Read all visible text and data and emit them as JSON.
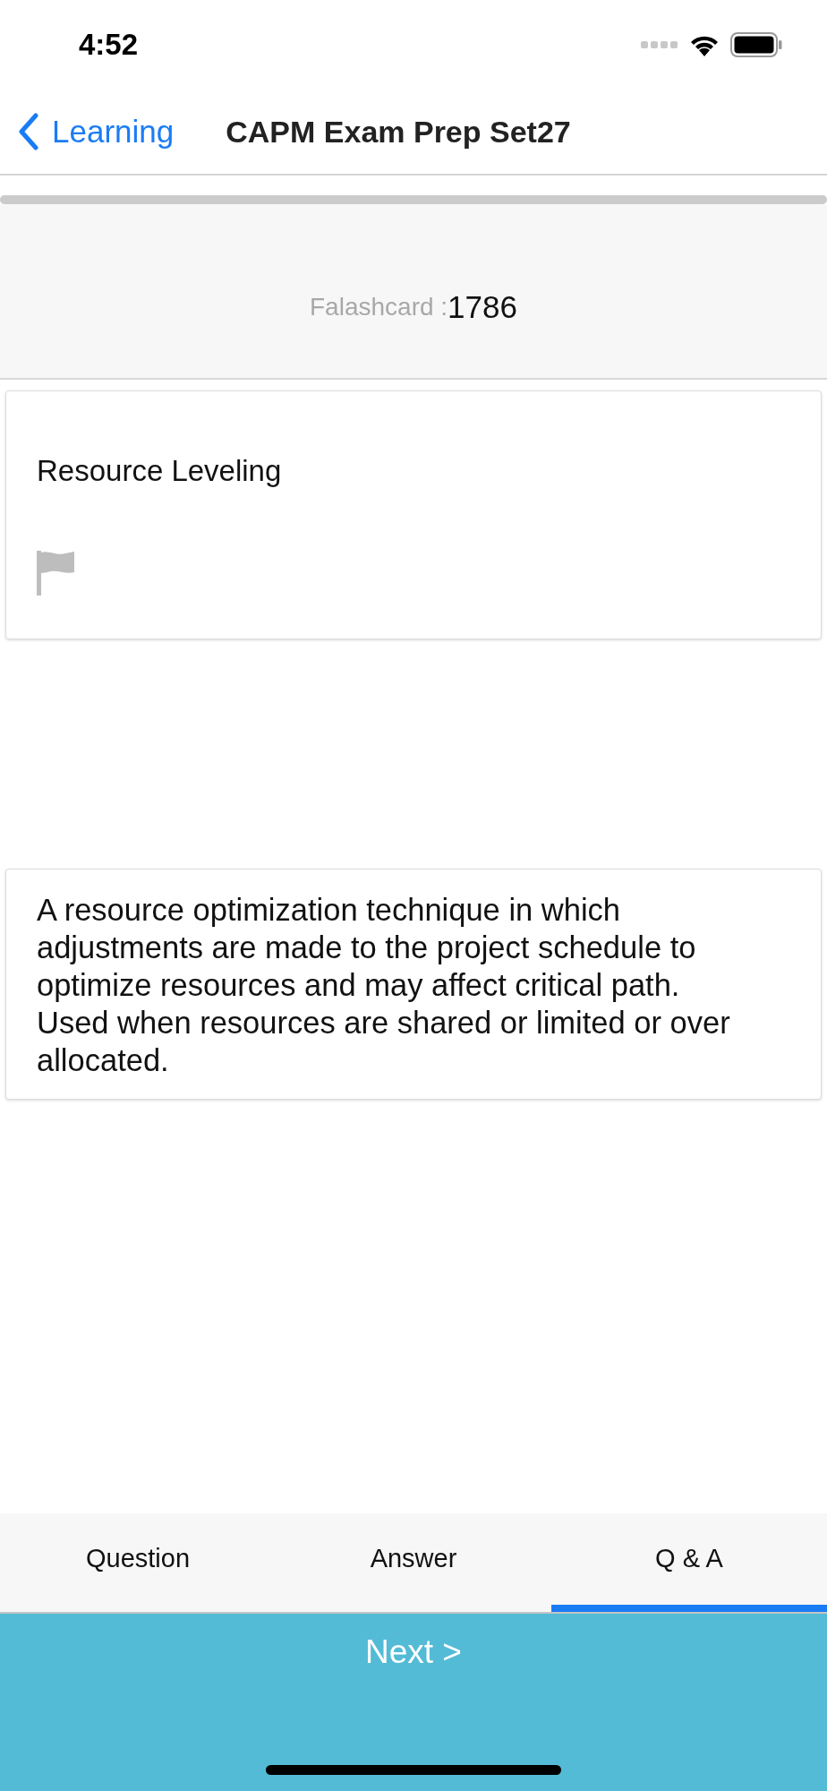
{
  "status_bar": {
    "time": "4:52"
  },
  "nav": {
    "back_label": "Learning",
    "title": "CAPM Exam Prep Set27"
  },
  "progress": {
    "level": 1
  },
  "header": {
    "label": "Falashcard :",
    "number": "1786"
  },
  "question": {
    "text": "Resource Leveling",
    "flagged": false
  },
  "answer": {
    "text": "A resource optimization technique in which adjustments are made to the project schedule to optimize resources and may affect critical path. Used when resources are shared or limited or over allocated."
  },
  "tabs": [
    {
      "label": "Question",
      "selected": false
    },
    {
      "label": "Answer",
      "selected": false
    },
    {
      "label": "Q & A",
      "selected": true
    }
  ],
  "next_button": {
    "label": "Next >"
  }
}
